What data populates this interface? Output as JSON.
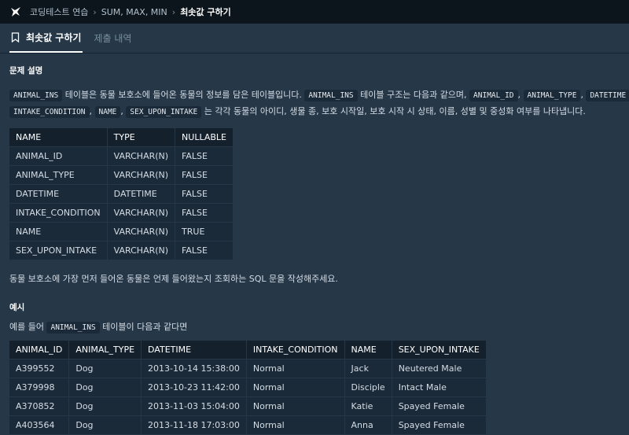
{
  "breadcrumb": {
    "items": [
      "코딩테스트 연습",
      "SUM, MAX, MIN",
      "최솟값 구하기"
    ]
  },
  "tabs": [
    {
      "label": "최솟값 구하기",
      "active": true
    },
    {
      "label": "제출 내역",
      "active": false
    }
  ],
  "problem": {
    "heading": "문제 설명",
    "line1": {
      "c1": "ANIMAL_INS",
      "t1": " 테이블은 동물 보호소에 들어온 동물의 정보를 담은 테이블입니다. ",
      "c2": "ANIMAL_INS",
      "t2": " 테이블 구조는 다음과 같으며, ",
      "c3": "ANIMAL_ID",
      "t3": ", ",
      "c4": "ANIMAL_TYPE",
      "t4": ", ",
      "c5": "DATETIME",
      "t5": ","
    },
    "line2": {
      "c1": "INTAKE_CONDITION",
      "t1": ", ",
      "c2": "NAME",
      "t2": ", ",
      "c3": "SEX_UPON_INTAKE",
      "t3": " 는 각각 동물의 아이디, 생물 종, 보호 시작일, 보호 시작 시 상태, 이름, 성별 및 중성화 여부를 나타냅니다."
    },
    "schema": {
      "headers": [
        "NAME",
        "TYPE",
        "NULLABLE"
      ],
      "rows": [
        [
          "ANIMAL_ID",
          "VARCHAR(N)",
          "FALSE"
        ],
        [
          "ANIMAL_TYPE",
          "VARCHAR(N)",
          "FALSE"
        ],
        [
          "DATETIME",
          "DATETIME",
          "FALSE"
        ],
        [
          "INTAKE_CONDITION",
          "VARCHAR(N)",
          "FALSE"
        ],
        [
          "NAME",
          "VARCHAR(N)",
          "TRUE"
        ],
        [
          "SEX_UPON_INTAKE",
          "VARCHAR(N)",
          "FALSE"
        ]
      ]
    },
    "question": "동물 보호소에 가장 먼저 들어온 동물은 언제 들어왔는지 조회하는 SQL 문을 작성해주세요."
  },
  "example": {
    "heading": "예시",
    "intro_pre": "예를 들어 ",
    "intro_code": "ANIMAL_INS",
    "intro_post": " 테이블이 다음과 같다면",
    "headers": [
      "ANIMAL_ID",
      "ANIMAL_TYPE",
      "DATETIME",
      "INTAKE_CONDITION",
      "NAME",
      "SEX_UPON_INTAKE"
    ],
    "rows": [
      [
        "A399552",
        "Dog",
        "2013-10-14 15:38:00",
        "Normal",
        "Jack",
        "Neutered Male"
      ],
      [
        "A379998",
        "Dog",
        "2013-10-23 11:42:00",
        "Normal",
        "Disciple",
        "Intact Male"
      ],
      [
        "A370852",
        "Dog",
        "2013-11-03 15:04:00",
        "Normal",
        "Katie",
        "Spayed Female"
      ],
      [
        "A403564",
        "Dog",
        "2013-11-18 17:03:00",
        "Normal",
        "Anna",
        "Spayed Female"
      ]
    ]
  }
}
